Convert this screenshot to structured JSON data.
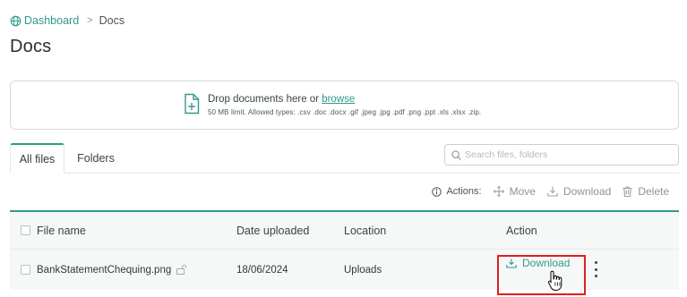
{
  "breadcrumb": {
    "home": "Dashboard",
    "separator": ">",
    "current": "Docs"
  },
  "page_title": "Docs",
  "dropzone": {
    "prefix": "Drop documents here or ",
    "browse": "browse",
    "limits": "50 MB limit. Allowed types: .csv .doc .docx .gif .jpeg .jpg .pdf .png .ppt .xls .xlsx .zip."
  },
  "tabs": {
    "all_files": "All files",
    "folders": "Folders"
  },
  "search": {
    "placeholder": "Search files, folders"
  },
  "actions": {
    "label": "Actions:",
    "move": "Move",
    "download": "Download",
    "delete": "Delete"
  },
  "table": {
    "columns": {
      "file_name": "File name",
      "date_uploaded": "Date uploaded",
      "location": "Location",
      "action": "Action"
    },
    "rows": [
      {
        "file_name": "BankStatementChequing.png",
        "date_uploaded": "18/06/2024",
        "location": "Uploads",
        "action": "Download"
      }
    ]
  },
  "colors": {
    "accent": "#2f9a8c",
    "highlight": "#e01e1e"
  }
}
